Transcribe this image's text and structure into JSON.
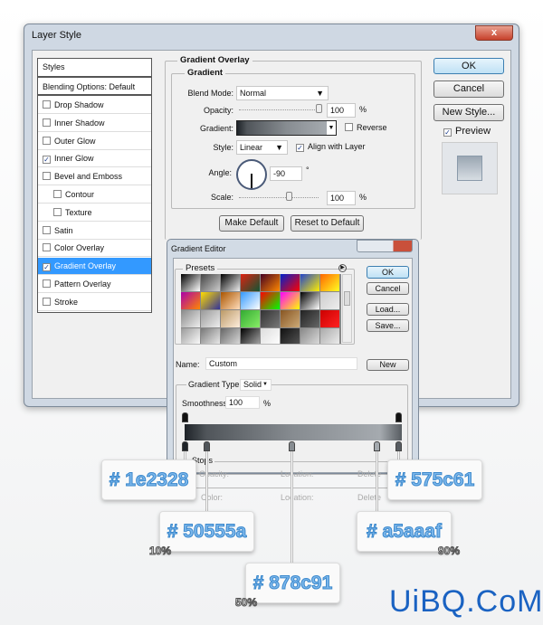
{
  "layer_style": {
    "title": "Layer Style",
    "close_label": "x",
    "styles_header": "Styles",
    "blending": "Blending Options: Default",
    "items": [
      {
        "label": "Drop Shadow",
        "checked": false
      },
      {
        "label": "Inner Shadow",
        "checked": false
      },
      {
        "label": "Outer Glow",
        "checked": false
      },
      {
        "label": "Inner Glow",
        "checked": true
      },
      {
        "label": "Bevel and Emboss",
        "checked": false
      },
      {
        "label": "Contour",
        "checked": false,
        "sub": true
      },
      {
        "label": "Texture",
        "checked": false,
        "sub": true
      },
      {
        "label": "Satin",
        "checked": false
      },
      {
        "label": "Color Overlay",
        "checked": false
      },
      {
        "label": "Gradient Overlay",
        "checked": true,
        "selected": true
      },
      {
        "label": "Pattern Overlay",
        "checked": false
      },
      {
        "label": "Stroke",
        "checked": false
      }
    ],
    "section": "Gradient Overlay",
    "group": "Gradient",
    "blend_mode_label": "Blend Mode:",
    "blend_mode": "Normal",
    "opacity_label": "Opacity:",
    "opacity": "100",
    "pct": "%",
    "gradient_label": "Gradient:",
    "reverse": "Reverse",
    "style_label": "Style:",
    "style": "Linear",
    "align": "Align with Layer",
    "angle_label": "Angle:",
    "angle": "-90",
    "degree": "°",
    "scale_label": "Scale:",
    "scale": "100",
    "make_default": "Make Default",
    "reset_default": "Reset to Default",
    "ok": "OK",
    "cancel": "Cancel",
    "new_style": "New Style...",
    "preview": "Preview"
  },
  "gradient_editor": {
    "title": "Gradient Editor",
    "presets": "Presets",
    "ok": "OK",
    "cancel": "Cancel",
    "load": "Load...",
    "save": "Save...",
    "name_label": "Name:",
    "name": "Custom",
    "new": "New",
    "type_label": "Gradient Type:",
    "type": "Solid",
    "smoothness_label": "Smoothness:",
    "smoothness": "100",
    "pct": "%",
    "stops": "Stops",
    "opacity": "Opacity:",
    "color": "Color:",
    "location": "Location:",
    "delete": "Delete",
    "preset_colors": [
      [
        "#000",
        "#fff"
      ],
      [
        "#444",
        "#ccc"
      ],
      [
        "#000",
        "#eee"
      ],
      [
        "#d21",
        "#153"
      ],
      [
        "#402",
        "#f80"
      ],
      [
        "#02c",
        "#f00"
      ],
      [
        "#24c",
        "#fe0"
      ],
      [
        "#f60",
        "#ff2"
      ],
      [
        "#a0a",
        "#f80"
      ],
      [
        "#fd0",
        "#339"
      ],
      [
        "#a50",
        "#fdb"
      ],
      [
        "#39f",
        "#fff"
      ],
      [
        "#f00",
        "#0f0"
      ],
      [
        "#f0f",
        "#ff0"
      ],
      [
        "#000",
        "#fff"
      ],
      [
        "#ccc",
        "#eee"
      ],
      [
        "#888",
        "#eee"
      ],
      [
        "#999",
        "#eee"
      ],
      [
        "#b96",
        "#fed"
      ],
      [
        "#3a3",
        "#8e6"
      ],
      [
        "#333",
        "#777"
      ],
      [
        "#852",
        "#ca7"
      ],
      [
        "#222",
        "#666"
      ],
      [
        "#c00",
        "#f22"
      ],
      [
        "#999",
        "#fff"
      ],
      [
        "#777",
        "#eee"
      ],
      [
        "#666",
        "#ddd"
      ],
      [
        "#000",
        "#aaa"
      ],
      [
        "#ddd",
        "#fff"
      ],
      [
        "#111",
        "#555"
      ],
      [
        "#888",
        "#ddd"
      ],
      [
        "#aaa",
        "#eee"
      ]
    ]
  },
  "stops": [
    {
      "color": "# 1e2328",
      "hex": "#1e2328",
      "location": 0
    },
    {
      "color": "# 50555a",
      "hex": "#50555a",
      "location": 10,
      "label": "10%"
    },
    {
      "color": "# 878c91",
      "hex": "#878c91",
      "location": 50,
      "label": "50%"
    },
    {
      "color": "# a5aaaf",
      "hex": "#a5aaaf",
      "location": 90,
      "label": "90%"
    },
    {
      "color": "# 575c61",
      "hex": "#575c61",
      "location": 100
    }
  ],
  "watermark": "UiBQ.CoM"
}
